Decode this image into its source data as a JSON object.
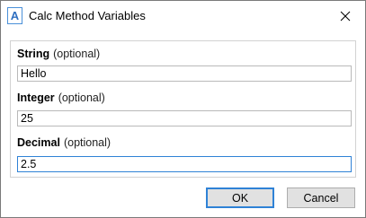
{
  "window": {
    "title": "Calc Method Variables",
    "icon": "A"
  },
  "fields": [
    {
      "name": "String",
      "optional_label": "(optional)",
      "value": "Hello"
    },
    {
      "name": "Integer",
      "optional_label": "(optional)",
      "value": "25"
    },
    {
      "name": "Decimal",
      "optional_label": "(optional)",
      "value": "2.5"
    }
  ],
  "buttons": {
    "ok_label": "OK",
    "cancel_label": "Cancel"
  },
  "icons": {
    "app": "app-letter-a-icon",
    "close": "close-icon"
  },
  "colors": {
    "accent": "#2f82d6",
    "button_face": "#e1e1e1",
    "panel_border": "#d2d2d2"
  }
}
